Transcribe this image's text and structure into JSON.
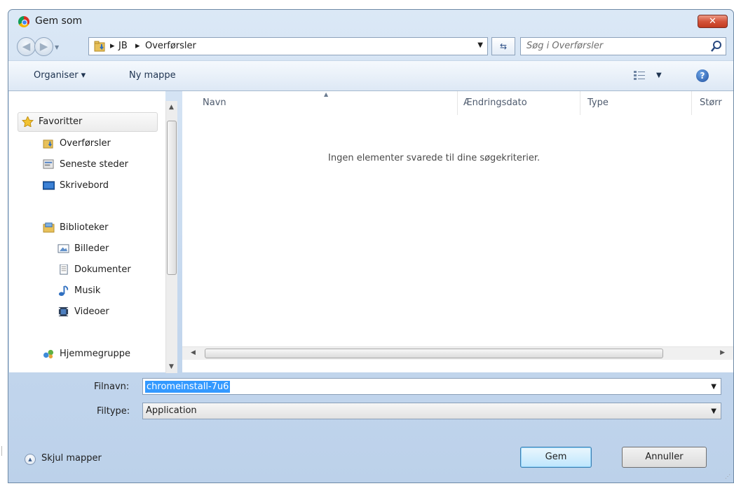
{
  "window": {
    "title": "Gem som",
    "close_symbol": "✕"
  },
  "address": {
    "crumbs": [
      "JB",
      "Overførsler"
    ]
  },
  "search": {
    "placeholder": "Søg i Overførsler"
  },
  "toolbar": {
    "organise_label": "Organiser ▾",
    "new_folder_label": "Ny mappe"
  },
  "nav": {
    "favorites": "Favoritter",
    "items": [
      "Overførsler",
      "Seneste steder",
      "Skrivebord"
    ],
    "libraries": "Biblioteker",
    "library_items": [
      "Billeder",
      "Dokumenter",
      "Musik",
      "Videoer"
    ],
    "homegroup": "Hjemmegruppe"
  },
  "columns": [
    "Navn",
    "Ændringsdato",
    "Type",
    "Størr"
  ],
  "empty_message": "Ingen elementer svarede til dine søgekriterier.",
  "form": {
    "filename_label": "Filnavn:",
    "filename_value": "chromeinstall-7u6",
    "filetype_label": "Filtype:",
    "filetype_value": "Application"
  },
  "footer": {
    "hide_folders_label": "Skjul mapper",
    "save_label": "Gem",
    "cancel_label": "Annuller"
  },
  "colors": {
    "selection": "#3399ff",
    "accent": "#3c7fb1"
  }
}
